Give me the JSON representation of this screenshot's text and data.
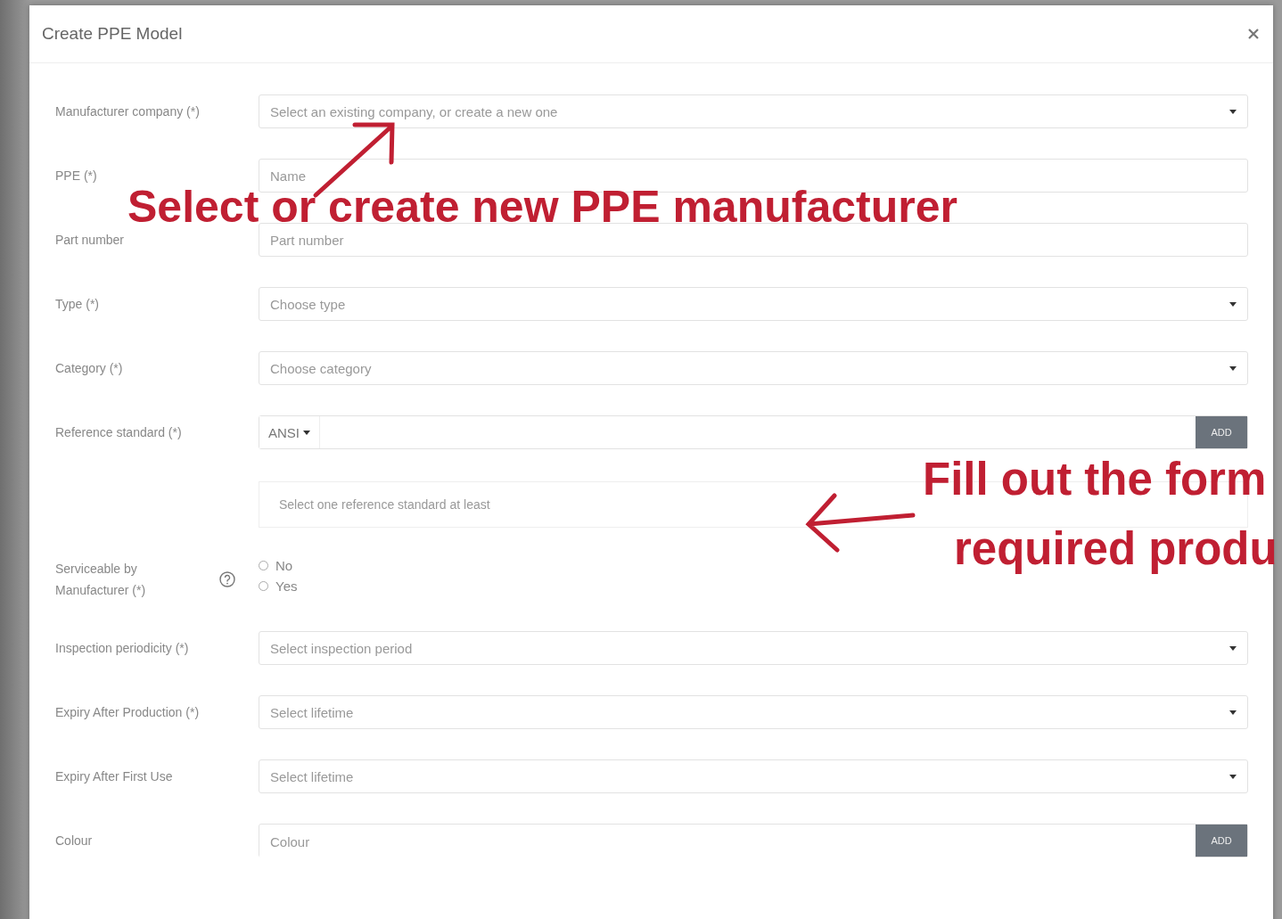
{
  "dialog": {
    "title": "Create PPE Model",
    "fields": [
      {
        "kind": "select",
        "label": "Manufacturer company (*)",
        "placeholder": "Select an existing company, or create a new one"
      },
      {
        "kind": "text",
        "label": "PPE (*)",
        "placeholder": "Name"
      },
      {
        "kind": "text",
        "label": "Part number",
        "placeholder": "Part number"
      },
      {
        "kind": "select",
        "label": "Type (*)",
        "placeholder": "Choose type"
      },
      {
        "kind": "select",
        "label": "Category (*)",
        "placeholder": "Choose category"
      },
      {
        "kind": "standard",
        "label": "Reference standard (*)",
        "value": "ANSI",
        "button": "ADD",
        "hint": "Select one reference standard at least"
      },
      {
        "kind": "radio",
        "label": "Serviceable by Manufacturer (*)",
        "options": [
          {
            "label": "No",
            "selected": false
          },
          {
            "label": "Yes",
            "selected": false
          }
        ]
      },
      {
        "kind": "select",
        "label": "Inspection periodicity (*)",
        "placeholder": "Select inspection period"
      },
      {
        "kind": "select",
        "label": "Expiry After Production (*)",
        "placeholder": "Select lifetime"
      },
      {
        "kind": "select",
        "label": "Expiry After First Use",
        "placeholder": "Select lifetime"
      },
      {
        "kind": "text_add",
        "label": "Colour",
        "placeholder": "Colour",
        "button": "ADD"
      }
    ]
  },
  "annotations": [
    {
      "kind": "manufacturer",
      "text": "Select or create new PPE manufacturer"
    },
    {
      "kind": "form",
      "text": "Fill out the form"
    },
    {
      "kind": "form_line",
      "text": "required produ"
    }
  ]
}
